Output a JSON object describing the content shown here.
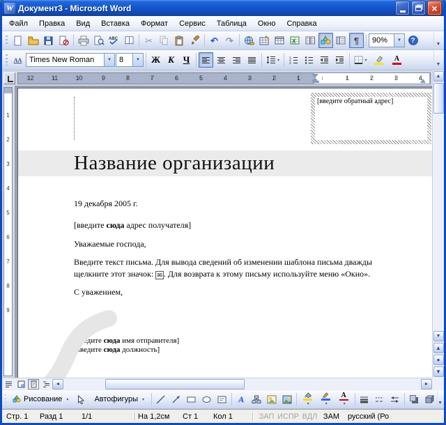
{
  "window": {
    "title": "Документ3 - Microsoft Word"
  },
  "icons": {
    "word_logo": "W",
    "close": "×",
    "cut": "✂",
    "undo": "↶",
    "redo": "↷",
    "pilcrow": "¶",
    "help": "?",
    "spelling_abc": "ABC",
    "styles": "АА",
    "wordart_letter": "А",
    "font_color_letter": "А",
    "envelope": "✉",
    "down": "▼",
    "up": "▲",
    "left": "◄",
    "right": "►",
    "chevron": "▾",
    "dot": "●"
  },
  "menu": {
    "items": [
      "Файл",
      "Правка",
      "Вид",
      "Вставка",
      "Формат",
      "Сервис",
      "Таблица",
      "Окно",
      "Справка"
    ]
  },
  "standard": {
    "zoom": "90%"
  },
  "formatting": {
    "font": "Times New Roman",
    "size": "8",
    "bold": "Ж",
    "italic": "К",
    "underline": "Ч"
  },
  "ruler": {
    "h_cells": [
      "12",
      "11",
      "10",
      "9",
      "8",
      "7",
      "6",
      "5",
      "4",
      "3",
      "2",
      "1",
      "",
      "1",
      "2",
      "3",
      "4"
    ],
    "v_cells": [
      "1",
      "2",
      "3",
      "4",
      "5",
      "6",
      "7",
      "8",
      "9"
    ]
  },
  "document": {
    "return_address": "[введите обратный адрес]",
    "org_name": "Название организации",
    "date": "19 декабря 2005 г.",
    "recipient_pre": "[введите ",
    "recipient_bold": "сюда",
    "recipient_post": " адрес получателя]",
    "salutation": "Уважаемые господа,",
    "body_line1": "Введите текст письма. Для вывода сведений об изменении шаблона письма дважды",
    "body_line2_pre": "щелкните этот значок: ",
    "body_line2_post": ". Для возврата к этому письму используйте меню «Окно».",
    "closing": "С уважением,",
    "sender_pre": "[введите ",
    "sender_bold": "сюда",
    "sender_post": " имя отправителя]",
    "role_pre": "[введите ",
    "role_bold": "сюда",
    "role_post": " должность]"
  },
  "drawing": {
    "menu_label": "Рисование",
    "autoshapes_label": "Автофигуры"
  },
  "status": {
    "page": "Стр. 1",
    "section": "Разд 1",
    "pages": "1/1",
    "at": "На 1,2см",
    "line": "Ст 1",
    "column": "Кол 1",
    "rec": "ЗАП",
    "trk": "ИСПР",
    "ext": "ВДЛ",
    "ovr": "ЗАМ",
    "lang": "русский (Ро"
  }
}
